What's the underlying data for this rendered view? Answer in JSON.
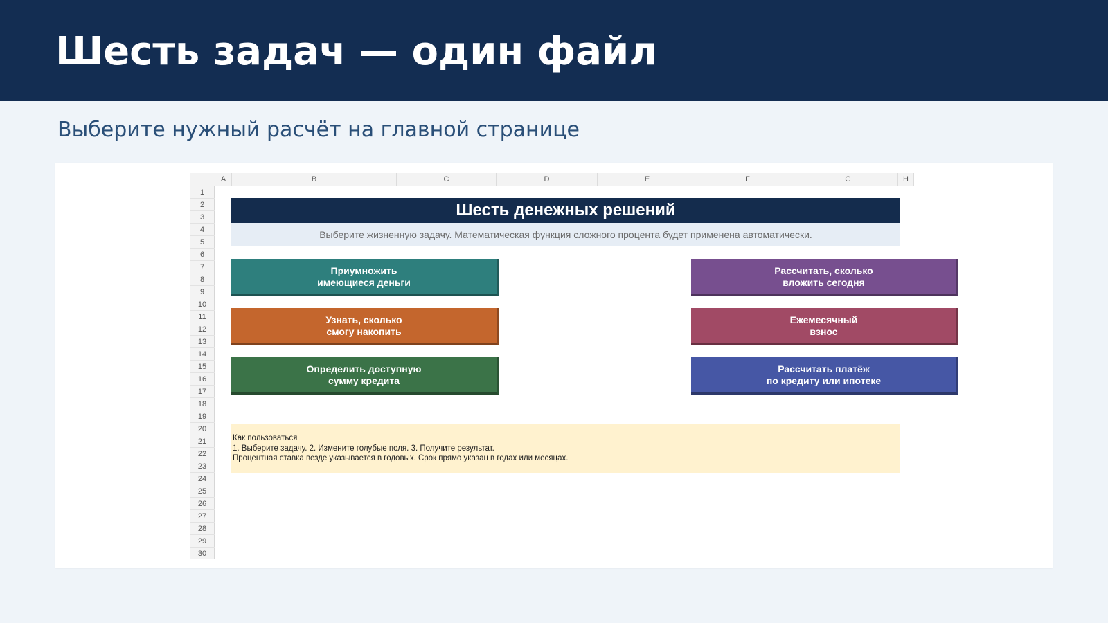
{
  "slide": {
    "title": "Шесть задач — один файл",
    "subtitle": "Выберите нужный расчёт на главной странице"
  },
  "sheet": {
    "columns": [
      "A",
      "B",
      "C",
      "D",
      "E",
      "F",
      "G",
      "H"
    ],
    "rows": [
      "1",
      "2",
      "3",
      "4",
      "5",
      "6",
      "7",
      "8",
      "9",
      "10",
      "11",
      "12",
      "13",
      "14",
      "15",
      "16",
      "17",
      "18",
      "19",
      "20",
      "21",
      "22",
      "23",
      "24",
      "25",
      "26",
      "27",
      "28",
      "29",
      "30"
    ],
    "banner_title": "Шесть денежных решений",
    "banner_subtitle": "Выберите жизненную задачу. Математическая функция сложного процента будет применена автоматически.",
    "tasks": [
      {
        "label": "Приумножить\nимеющиеся деньги",
        "color": "#2e7f7d"
      },
      {
        "label": "Рассчитать, сколько\nвложить сегодня",
        "color": "#774f8f"
      },
      {
        "label": "Узнать, сколько\nсмогу накопить",
        "color": "#c4662d"
      },
      {
        "label": "Ежемесячный\nвзнос",
        "color": "#a14a65"
      },
      {
        "label": "Определить доступную\nсумму кредита",
        "color": "#3b7348"
      },
      {
        "label": "Рассчитать платёж\nпо кредиту или ипотеке",
        "color": "#4657a5"
      }
    ],
    "howto": {
      "heading": "Как пользоваться",
      "line1": "1. Выберите задачу.  2. Измените голубые поля.  3. Получите результат.",
      "line2": "Процентная ставка везде указывается в годовых. Срок прямо указан в годах или месяцах."
    }
  }
}
